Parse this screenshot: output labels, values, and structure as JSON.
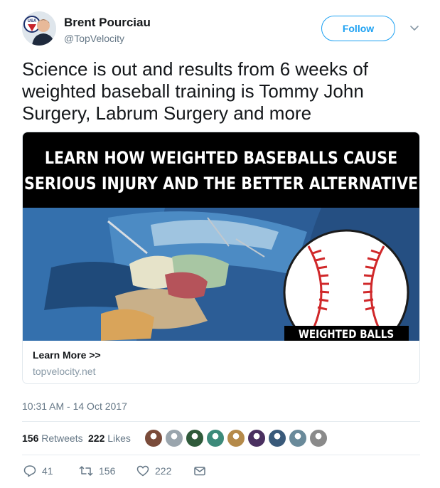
{
  "author": {
    "name": "Brent Pourciau",
    "handle": "@TopVelocity",
    "follow_label": "Follow",
    "avatar_badge_text": "USA"
  },
  "tweet": {
    "text": "Science is out and results from 6 weeks of weighted baseball training is Tommy John Surgery, Labrum Surgery and more",
    "timestamp": "10:31 AM - 14 Oct 2017"
  },
  "card": {
    "headline_line1": "LEARN HOW WEIGHTED BASEBALLS CAUSE",
    "headline_line2": "SERIOUS INJURY AND THE BETTER ALTERNATIVE",
    "image_caption": "WEIGHTED BALLS",
    "title": "Learn More >>",
    "domain": "topvelocity.net"
  },
  "stats": {
    "retweets_count": "156",
    "retweets_label": "Retweets",
    "likes_count": "222",
    "likes_label": "Likes",
    "liker_avatar_colors": [
      "#7a4b3a",
      "#9aa5ad",
      "#2f5a3a",
      "#3d8a7a",
      "#b58a4a",
      "#4a3060",
      "#3a5a7a",
      "#6a8a9a",
      "#8a8a8a"
    ]
  },
  "actions": {
    "replies": "41",
    "retweets": "156",
    "likes": "222"
  },
  "colors": {
    "accent": "#1da1f2",
    "text": "#14171a",
    "muted": "#657786",
    "border": "#e1e8ed",
    "card_banner": "#000000",
    "ball_stitch": "#d0282a"
  }
}
